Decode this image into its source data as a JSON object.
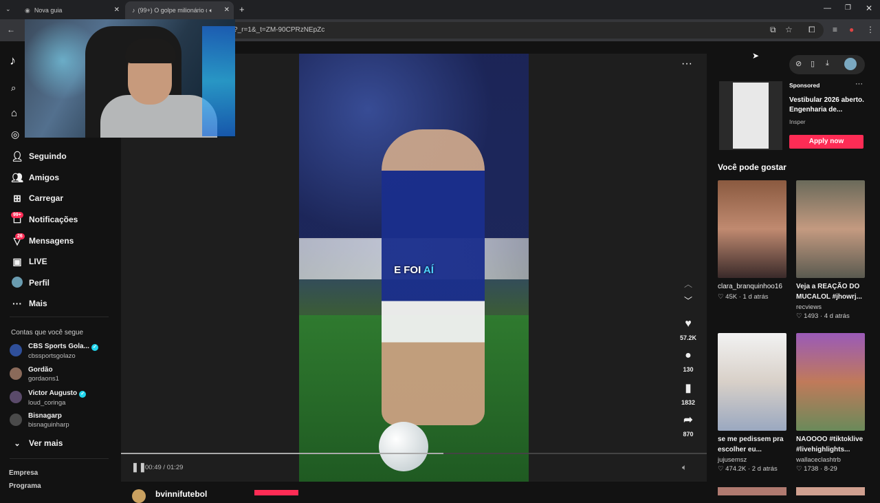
{
  "browser": {
    "tabs": [
      {
        "label": "Nova guia",
        "active": false
      },
      {
        "label": "(99+) O golpe milionário do",
        "active": true
      }
    ],
    "url": "?_r=1&_t=ZM-90CPRzNEpZc"
  },
  "sidebar": {
    "nav": [
      {
        "label": "Seguindo",
        "icon": "user-follow-icon"
      },
      {
        "label": "Amigos",
        "icon": "friends-icon"
      },
      {
        "label": "Carregar",
        "icon": "upload-icon"
      },
      {
        "label": "Notificações",
        "icon": "notification-icon",
        "badge": "99+"
      },
      {
        "label": "Mensagens",
        "icon": "message-icon",
        "badge": "26"
      },
      {
        "label": "LIVE",
        "icon": "live-icon"
      },
      {
        "label": "Perfil",
        "icon": "profile-avatar"
      },
      {
        "label": "Mais",
        "icon": "more-icon"
      }
    ],
    "following_title": "Contas que você segue",
    "following": [
      {
        "name": "CBS Sports Gola...",
        "handle": "cbssportsgolazo",
        "verified": true
      },
      {
        "name": "Gordão",
        "handle": "gordaons1",
        "verified": false
      },
      {
        "name": "Victor Augusto",
        "handle": "loud_coringa",
        "verified": true
      },
      {
        "name": "Bisnagarp",
        "handle": "bisnaguinharp",
        "verified": false
      }
    ],
    "see_more": "Ver mais",
    "footer": [
      "Empresa",
      "Programa"
    ]
  },
  "video": {
    "caption_white": "E FOI",
    "caption_blue": "AÍ",
    "time": "00:49 / 01:29",
    "progress": 0.55,
    "likes": "57.2K",
    "comments": "130",
    "saves": "1832",
    "shares": "870",
    "author": "bvinnifutebol"
  },
  "ad": {
    "sponsored": "Sponsored",
    "title_line1": "Vestibular 2026 aberto.",
    "title_line2": "Engenharia de...",
    "advertiser": "Insper",
    "cta": "Apply now"
  },
  "recommendations": {
    "title": "Você pode gostar",
    "items": [
      {
        "title": "clara_branquinhoo16",
        "author": "",
        "likes": "45K",
        "ago": "1 d atrás",
        "bold": false,
        "color": "#b07060"
      },
      {
        "title": "Veja a REAÇÃO DO MUCALOL #jhowrj...",
        "author": "recviews",
        "likes": "1493",
        "ago": "4 d atrás",
        "bold": true,
        "color": "#6f6f6a"
      },
      {
        "title": "se me pedissem pra escolher eu...",
        "author": "jujusemsz",
        "likes": "474.2K",
        "ago": "2 d atrás",
        "bold": true,
        "color": "#e6e6e6"
      },
      {
        "title": "NAOOOO #tiktoklive #livehighlights...",
        "author": "wallaceclashtrb",
        "likes": "1738",
        "ago": "8-29",
        "bold": true,
        "color": "#8a4aa8"
      }
    ]
  },
  "colors": {
    "accent": "#fe2c55",
    "verified": "#20d5ec"
  }
}
